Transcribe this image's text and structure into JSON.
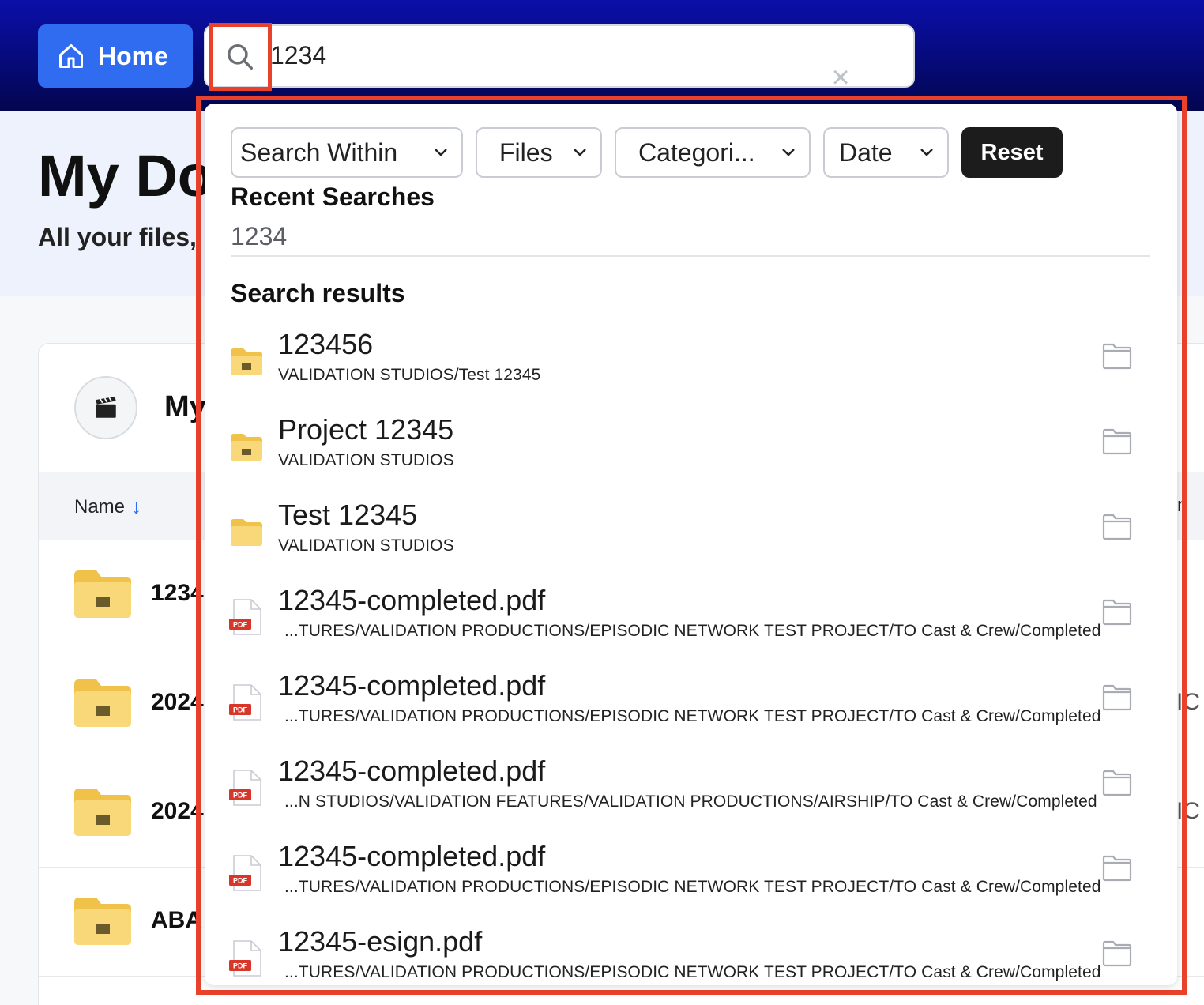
{
  "header": {
    "home_label": "Home",
    "search_value": "1234",
    "search_placeholder": "",
    "clear_glyph": "×"
  },
  "page": {
    "title": "My Do",
    "subtitle": "All your files,"
  },
  "card": {
    "title": "My",
    "column_name": "Name",
    "column_right": "n",
    "rows": [
      {
        "name": "1234",
        "side": ""
      },
      {
        "name": "2024",
        "side": "IC"
      },
      {
        "name": "2024",
        "side": "IC"
      },
      {
        "name": "ABA",
        "side": ""
      }
    ]
  },
  "panel": {
    "filters": [
      {
        "label": "Search Within"
      },
      {
        "label": "Files"
      },
      {
        "label": "Categori..."
      },
      {
        "label": "Date"
      }
    ],
    "reset_label": "Reset",
    "recent_heading": "Recent Searches",
    "recent_items": [
      "1234"
    ],
    "results_heading": "Search results",
    "results": [
      {
        "type": "folder-clapper",
        "name": "123456",
        "path": "VALIDATION STUDIOS/Test 12345",
        "ellipsis": false
      },
      {
        "type": "folder-clapper",
        "name": "Project 12345",
        "path": "VALIDATION STUDIOS",
        "ellipsis": false
      },
      {
        "type": "folder",
        "name": "Test 12345",
        "path": "VALIDATION STUDIOS",
        "ellipsis": false
      },
      {
        "type": "pdf",
        "name": "12345-completed.pdf",
        "path": "...TURES/VALIDATION PRODUCTIONS/EPISODIC NETWORK TEST PROJECT/TO Cast & Crew/Completed",
        "ellipsis": true
      },
      {
        "type": "pdf",
        "name": "12345-completed.pdf",
        "path": "...TURES/VALIDATION PRODUCTIONS/EPISODIC NETWORK TEST PROJECT/TO Cast & Crew/Completed",
        "ellipsis": true
      },
      {
        "type": "pdf",
        "name": "12345-completed.pdf",
        "path": "...N STUDIOS/VALIDATION FEATURES/VALIDATION PRODUCTIONS/AIRSHIP/TO Cast & Crew/Completed",
        "ellipsis": true
      },
      {
        "type": "pdf",
        "name": "12345-completed.pdf",
        "path": "...TURES/VALIDATION PRODUCTIONS/EPISODIC NETWORK TEST PROJECT/TO Cast & Crew/Completed",
        "ellipsis": true
      },
      {
        "type": "pdf",
        "name": "12345-esign.pdf",
        "path": "...TURES/VALIDATION PRODUCTIONS/EPISODIC NETWORK TEST PROJECT/TO Cast & Crew/Completed",
        "ellipsis": true
      }
    ],
    "pdf_badge": "PDF"
  },
  "colors": {
    "accent": "#2f6cf0",
    "highlight": "#e8412c",
    "folder": "#f7d46b"
  }
}
